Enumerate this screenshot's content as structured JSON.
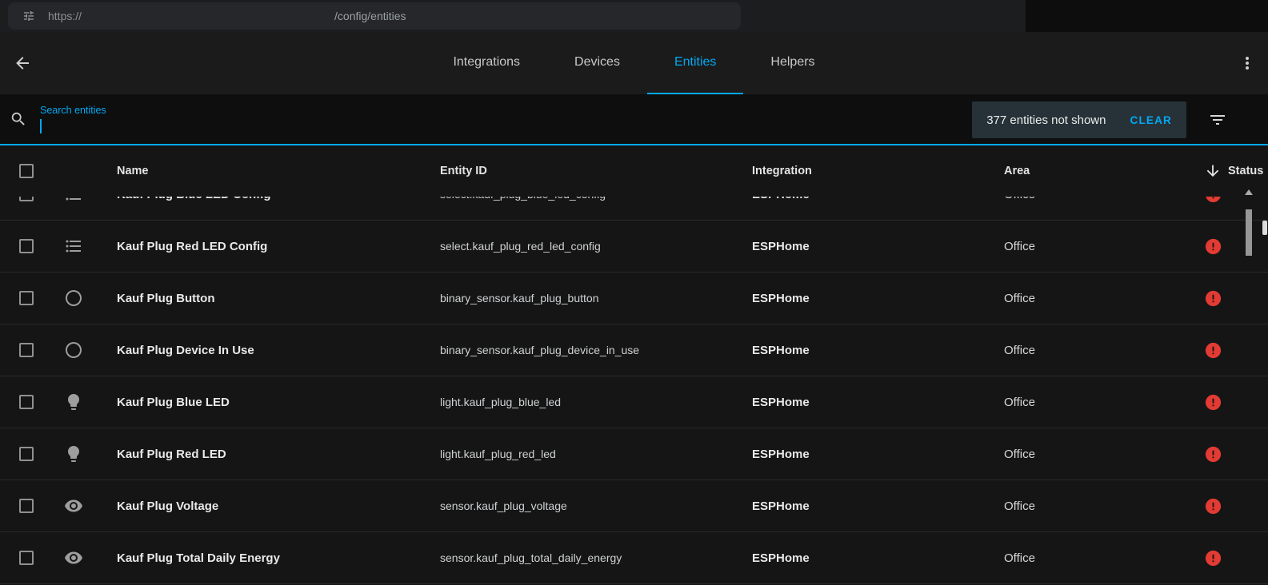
{
  "colors": {
    "accent": "#03a9f4",
    "error": "#e23b33"
  },
  "browser": {
    "url_prefix": "https://",
    "url_path": "/config/entities"
  },
  "header": {
    "tabs": [
      {
        "label": "Integrations",
        "active": false
      },
      {
        "label": "Devices",
        "active": false
      },
      {
        "label": "Entities",
        "active": true
      },
      {
        "label": "Helpers",
        "active": false
      }
    ]
  },
  "search": {
    "label": "Search entities",
    "not_shown": "377 entities not shown",
    "clear": "CLEAR"
  },
  "table": {
    "columns": {
      "name": "Name",
      "entity_id": "Entity ID",
      "integration": "Integration",
      "area": "Area",
      "status": "Status"
    },
    "rows": [
      {
        "name": "Kauf Plug Blue LED Config",
        "entity_id": "select.kauf_plug_blue_led_config",
        "integration": "ESPHome",
        "area": "Office",
        "icon": "list",
        "status": "error",
        "partial": true
      },
      {
        "name": "Kauf Plug Red LED Config",
        "entity_id": "select.kauf_plug_red_led_config",
        "integration": "ESPHome",
        "area": "Office",
        "icon": "list",
        "status": "error",
        "partial": false
      },
      {
        "name": "Kauf Plug Button",
        "entity_id": "binary_sensor.kauf_plug_button",
        "integration": "ESPHome",
        "area": "Office",
        "icon": "circle",
        "status": "error",
        "partial": false
      },
      {
        "name": "Kauf Plug Device In Use",
        "entity_id": "binary_sensor.kauf_plug_device_in_use",
        "integration": "ESPHome",
        "area": "Office",
        "icon": "circle",
        "status": "error",
        "partial": false
      },
      {
        "name": "Kauf Plug Blue LED",
        "entity_id": "light.kauf_plug_blue_led",
        "integration": "ESPHome",
        "area": "Office",
        "icon": "bulb",
        "status": "error",
        "partial": false
      },
      {
        "name": "Kauf Plug Red LED",
        "entity_id": "light.kauf_plug_red_led",
        "integration": "ESPHome",
        "area": "Office",
        "icon": "bulb",
        "status": "error",
        "partial": false
      },
      {
        "name": "Kauf Plug Voltage",
        "entity_id": "sensor.kauf_plug_voltage",
        "integration": "ESPHome",
        "area": "Office",
        "icon": "eye",
        "status": "error",
        "partial": false
      },
      {
        "name": "Kauf Plug Total Daily Energy",
        "entity_id": "sensor.kauf_plug_total_daily_energy",
        "integration": "ESPHome",
        "area": "Office",
        "icon": "eye",
        "status": "error",
        "partial": false
      }
    ]
  }
}
